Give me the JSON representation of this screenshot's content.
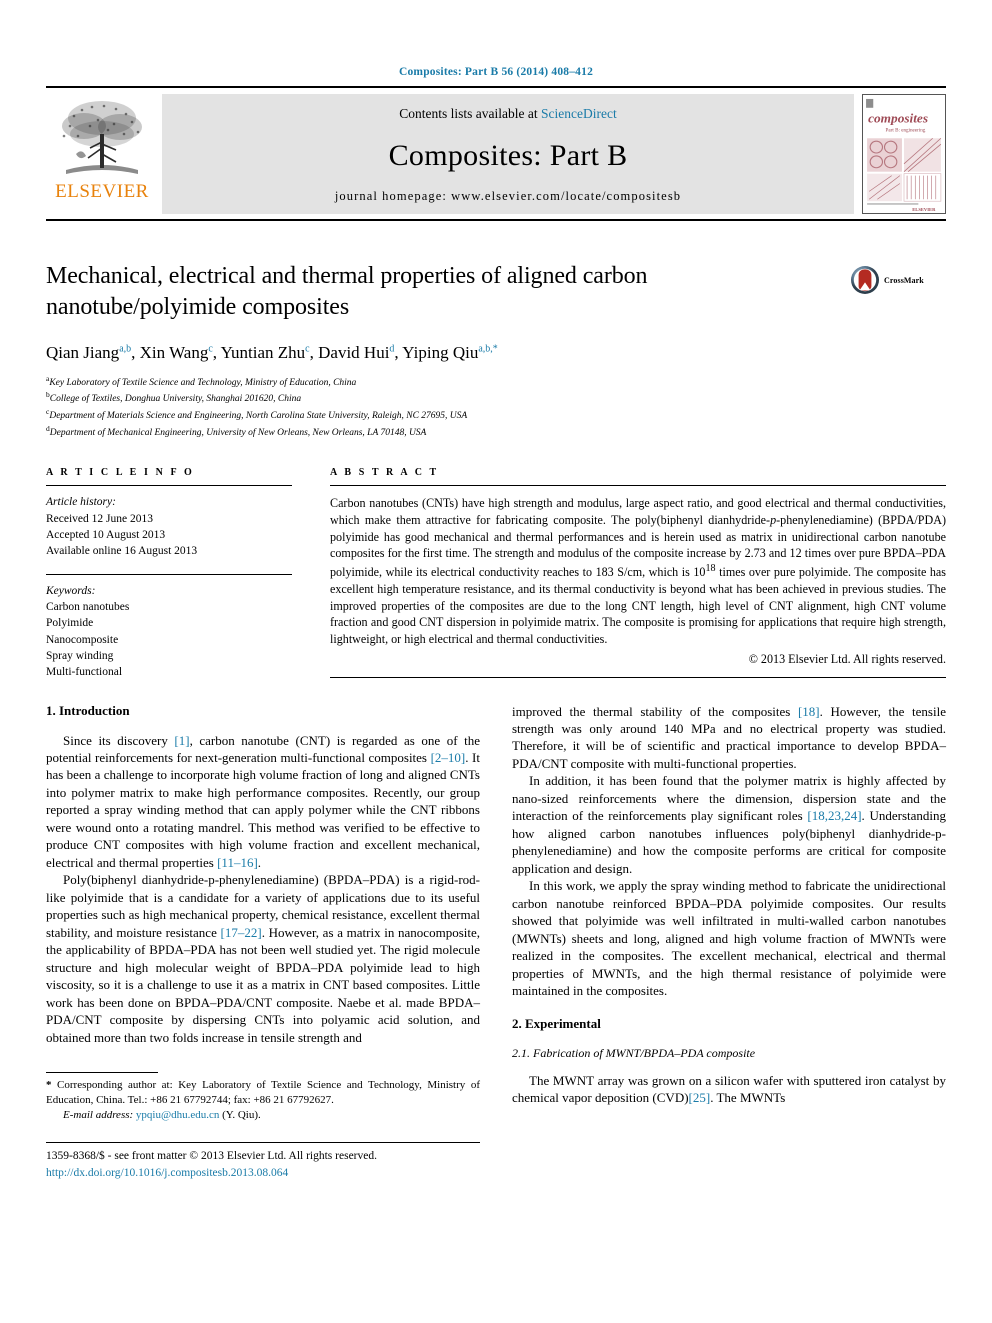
{
  "running_head": "Composites: Part B 56 (2014) 408–412",
  "masthead": {
    "publisher": "ELSEVIER",
    "contents_prefix": "Contents lists available at ",
    "contents_link": "ScienceDirect",
    "journal_title": "Composites: Part B",
    "homepage": "journal homepage: www.elsevier.com/locate/compositesb",
    "cover_title": "composites",
    "cover_subtitle": "Part B: engineering"
  },
  "article": {
    "title": "Mechanical, electrical and thermal properties of aligned carbon nanotube/polyimide composites",
    "crossmark_label": "CrossMark",
    "authors_html": "Qian Jiang<sup>a,b</sup>, Xin Wang<sup>c</sup>, Yuntian Zhu<sup>c</sup>, David Hui<sup>d</sup>, Yiping Qiu<sup>a,b,</sup><sup class=\"star\">*</sup>",
    "affiliations": [
      {
        "mark": "a",
        "text": "Key Laboratory of Textile Science and Technology, Ministry of Education, China"
      },
      {
        "mark": "b",
        "text": "College of Textiles, Donghua University, Shanghai 201620, China"
      },
      {
        "mark": "c",
        "text": "Department of Materials Science and Engineering, North Carolina State University, Raleigh, NC 27695, USA"
      },
      {
        "mark": "d",
        "text": "Department of Mechanical Engineering, University of New Orleans, New Orleans, LA 70148, USA"
      }
    ]
  },
  "article_info": {
    "heading": "A R T I C L E   I N F O",
    "history_label": "Article history:",
    "history": [
      "Received 12 June 2013",
      "Accepted 10 August 2013",
      "Available online 16 August 2013"
    ],
    "keywords_label": "Keywords:",
    "keywords": [
      "Carbon nanotubes",
      "Polyimide",
      "Nanocomposite",
      "Spray winding",
      "Multi-functional"
    ]
  },
  "abstract": {
    "heading": "A B S T R A C T",
    "text_html": "Carbon nanotubes (CNTs) have high strength and modulus, large aspect ratio, and good electrical and thermal conductivities, which make them attractive for fabricating composite. The poly(biphenyl dianhydride-<i>p</i>-phenylenediamine) (BPDA/PDA) polyimide has good mechanical and thermal performances and is herein used as matrix in unidirectional carbon nanotube composites for the first time. The strength and modulus of the composite increase by 2.73 and 12 times over pure BPDA–PDA polyimide, while its electrical conductivity reaches to 183 S/cm, which is 10<sup>18</sup> times over pure polyimide. The composite has excellent high temperature resistance, and its thermal conductivity is beyond what has been achieved in previous studies. The improved properties of the composites are due to the long CNT length, high level of CNT alignment, high CNT volume fraction and good CNT dispersion in polyimide matrix. The composite is promising for applications that require high strength, lightweight, or high electrical and thermal conductivities.",
    "copyright": "© 2013 Elsevier Ltd. All rights reserved."
  },
  "body": {
    "intro_heading": "1. Introduction",
    "intro_p1_html": "Since its discovery <span class=\"ref\">[1]</span>, carbon nanotube (CNT) is regarded as one of the potential reinforcements for next-generation multi-functional composites <span class=\"ref\">[2–10]</span>. It has been a challenge to incorporate high volume fraction of long and aligned CNTs into polymer matrix to make high performance composites. Recently, our group reported a spray winding method that can apply polymer while the CNT ribbons were wound onto a rotating mandrel. This method was verified to be effective to produce CNT composites with high volume fraction and excellent mechanical, electrical and thermal properties <span class=\"ref\">[11–16]</span>.",
    "intro_p2_html": "Poly(biphenyl dianhydride-p-phenylenediamine) (BPDA–PDA) is a rigid-rod-like polyimide that is a candidate for a variety of applications due to its useful properties such as high mechanical property, chemical resistance, excellent thermal stability, and moisture resistance <span class=\"ref\">[17–22]</span>. However, as a matrix in nanocomposite, the applicability of BPDA–PDA has not been well studied yet. The rigid molecule structure and high molecular weight of BPDA–PDA polyimide lead to high viscosity, so it is a challenge to use it as a matrix in CNT based composites. Little work has been done on BPDA–PDA/CNT composite. Naebe et al. made BPDA–PDA/CNT composite by dispersing CNTs into polyamic acid solution, and obtained more than two folds increase in tensile strength and",
    "right_p1_html": "improved the thermal stability of the composites <span class=\"ref\">[18]</span>. However, the tensile strength was only around 140 MPa and no electrical property was studied. Therefore, it will be of scientific and practical importance to develop BPDA–PDA/CNT composite with multi-functional properties.",
    "right_p2_html": "In addition, it has been found that the polymer matrix is highly affected by nano-sized reinforcements where the dimension, dispersion state and the interaction of the reinforcements play significant roles <span class=\"ref\">[18,23,24]</span>. Understanding how aligned carbon nanotubes influences poly(biphenyl dianhydride-p-phenylenediamine) and how the composite performs are critical for composite application and design.",
    "right_p3_html": "In this work, we apply the spray winding method to fabricate the unidirectional carbon nanotube reinforced BPDA–PDA polyimide composites. Our results showed that polyimide was well infiltrated in multi-walled carbon nanotubes (MWNTs) sheets and long, aligned and high volume fraction of MWNTs were realized in the composites. The excellent mechanical, electrical and thermal properties of MWNTs, and the high thermal resistance of polyimide were maintained in the composites.",
    "experimental_heading": "2. Experimental",
    "experimental_sub": "2.1. Fabrication of MWNT/BPDA–PDA composite",
    "experimental_p1_html": "The MWNT array was grown on a silicon wafer with sputtered iron catalyst by chemical vapor deposition (CVD)<span class=\"ref\">[25]</span>. The MWNTs"
  },
  "footer": {
    "corresponding_html": "<b>*</b> Corresponding author at: Key Laboratory of Textile Science and Technology, Ministry of Education, China. Tel.: +86 21 67792744; fax: +86 21 67792627.",
    "email_label": "E-mail address:",
    "email": "ypqiu@dhu.edu.cn",
    "email_suffix": "(Y. Qiu).",
    "issn_line": "1359-8368/$ - see front matter © 2013 Elsevier Ltd. All rights reserved.",
    "doi": "http://dx.doi.org/10.1016/j.compositesb.2013.08.064"
  },
  "colors": {
    "link": "#1a7ba8",
    "elsevier_orange": "#E8820C",
    "masthead_gray": "#e3e3e3",
    "cover_maroon": "#9e4a55"
  }
}
